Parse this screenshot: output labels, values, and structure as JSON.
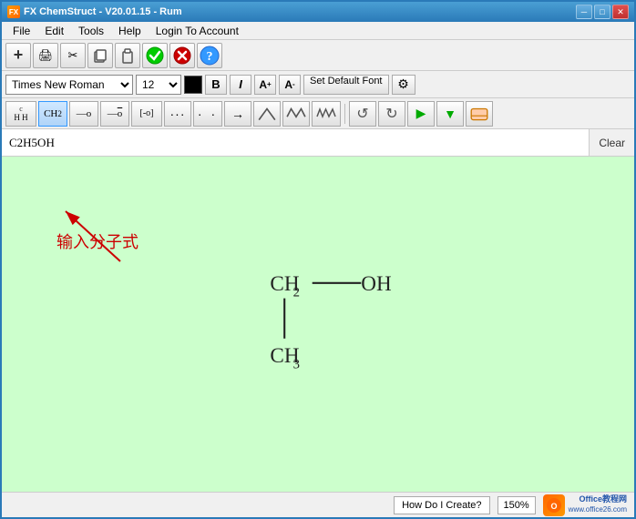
{
  "titlebar": {
    "icon_label": "FX",
    "title": "FX ChemStruct - V20.01.15 - Rum",
    "min_btn": "─",
    "max_btn": "□",
    "close_btn": "✕"
  },
  "menubar": {
    "items": [
      "File",
      "Edit",
      "Tools",
      "Help",
      "Login To Account"
    ]
  },
  "toolbar1": {
    "buttons": [
      {
        "name": "add",
        "icon": "+",
        "label": "Add"
      },
      {
        "name": "print",
        "icon": "🖨",
        "label": "Print"
      },
      {
        "name": "cut",
        "icon": "✂",
        "label": "Cut"
      },
      {
        "name": "copy",
        "icon": "📋",
        "label": "Copy"
      },
      {
        "name": "paste",
        "icon": "📄",
        "label": "Paste"
      },
      {
        "name": "ok",
        "icon": "✔",
        "label": "OK",
        "color": "green"
      },
      {
        "name": "cancel",
        "icon": "✕",
        "label": "Cancel",
        "color": "red"
      },
      {
        "name": "help",
        "icon": "?",
        "label": "Help",
        "color": "blue"
      }
    ]
  },
  "toolbar2": {
    "font_name": "Times New Roman",
    "font_size": "12",
    "bold_label": "B",
    "italic_label": "I",
    "superscript_label": "A",
    "subscript_label": "A",
    "set_default_label": "Set Default Font",
    "gear_icon": "⚙"
  },
  "toolbar3": {
    "buttons": [
      {
        "name": "ch-group",
        "label": "C\nH H",
        "type": "chem"
      },
      {
        "name": "ch2-group",
        "label": "CH₂",
        "type": "chem"
      },
      {
        "name": "single-bond-left",
        "label": "—o",
        "type": "chem"
      },
      {
        "name": "single-bond-right",
        "label": "—o̅",
        "type": "chem"
      },
      {
        "name": "bracket",
        "label": "[-o]",
        "type": "chem"
      },
      {
        "name": "dots3",
        "label": "···",
        "type": "chem"
      },
      {
        "name": "dots2",
        "label": "·  ·",
        "type": "chem"
      },
      {
        "name": "arrow-right",
        "label": "→",
        "type": "chem"
      },
      {
        "name": "zigzag1",
        "label": "∧",
        "type": "chem"
      },
      {
        "name": "zigzag2",
        "label": "∧∧",
        "type": "chem"
      },
      {
        "name": "zigzag3",
        "label": "∧∧∧",
        "type": "chem"
      },
      {
        "name": "undo",
        "label": "↺",
        "type": "action"
      },
      {
        "name": "redo",
        "label": "↻",
        "type": "action"
      },
      {
        "name": "forward",
        "label": "▶",
        "type": "action",
        "color": "green"
      },
      {
        "name": "down",
        "label": "▼",
        "type": "action",
        "color": "green"
      },
      {
        "name": "eraser",
        "label": "⌫",
        "type": "action"
      }
    ]
  },
  "formula_area": {
    "input_value": "C2H5OH",
    "clear_label": "Clear"
  },
  "canvas": {
    "background": "#ccffcc",
    "annotation_text": "输入分子式",
    "structure_label": "CH₂—OH above, CH₃ below"
  },
  "statusbar": {
    "how_do_i": "How Do I Create?",
    "zoom": "150%",
    "office_line1": "Office教程网",
    "office_line2": "www.office26.com"
  }
}
